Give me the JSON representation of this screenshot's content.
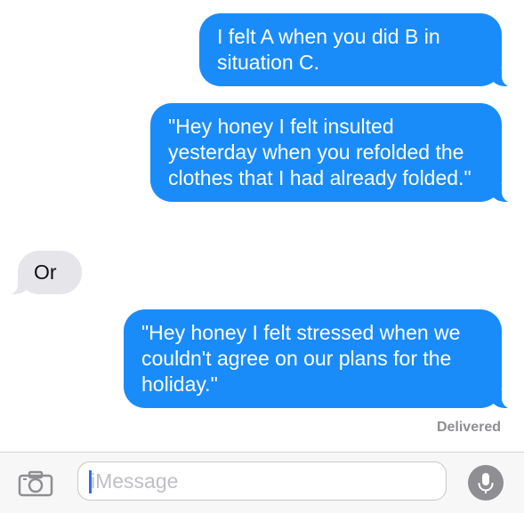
{
  "messages": [
    {
      "direction": "sent",
      "text": "I felt A when you did B in situation C."
    },
    {
      "direction": "sent",
      "text": "\"Hey honey I felt insulted yesterday when you refolded the clothes that I had already folded.\""
    },
    {
      "direction": "received",
      "text": "Or"
    },
    {
      "direction": "sent",
      "text": "\"Hey honey I felt stressed when we couldn't agree on our plans for the holiday.\""
    }
  ],
  "status": {
    "delivered": "Delivered"
  },
  "composer": {
    "placeholder": "iMessage"
  },
  "icons": {
    "camera": "camera-icon",
    "mic": "microphone-icon"
  },
  "colors": {
    "sent": "#1a8cf9",
    "received": "#e6e5ea",
    "cursor": "#2f6ff0"
  }
}
